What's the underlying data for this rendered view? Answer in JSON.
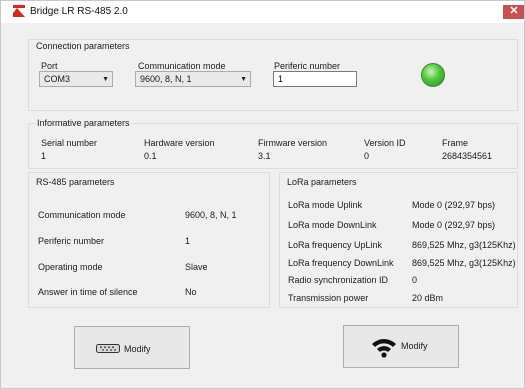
{
  "window": {
    "title": "Bridge LR RS-485 2.0",
    "close_label": "✕"
  },
  "connection": {
    "title": "Connection parameters",
    "port_label": "Port",
    "port_value": "COM3",
    "mode_label": "Communication mode",
    "mode_value": "9600, 8, N, 1",
    "periferic_label": "Periferic number",
    "periferic_value": "1",
    "status_color": "#4cc43a"
  },
  "informative": {
    "title": "Informative parameters",
    "serial_label": "Serial number",
    "serial_value": "1",
    "hw_label": "Hardware version",
    "hw_value": "0.1",
    "fw_label": "Firmware version",
    "fw_value": "3.1",
    "vid_label": "Version ID",
    "vid_value": "0",
    "frame_label": "Frame",
    "frame_value": "2684354561"
  },
  "rs485": {
    "title": "RS-485 parameters",
    "rows": [
      {
        "label": "Communication mode",
        "value": "9600, 8, N, 1"
      },
      {
        "label": "Periferic number",
        "value": "1"
      },
      {
        "label": "Operating mode",
        "value": "Slave"
      },
      {
        "label": "Answer in time of silence",
        "value": "No"
      }
    ],
    "modify_label": "Modify",
    "modify_icon": "serial-port-icon"
  },
  "lora": {
    "title": "LoRa parameters",
    "rows": [
      {
        "label": "LoRa mode Uplink",
        "value": "Mode 0 (292,97 bps)"
      },
      {
        "label": "LoRa mode DownLink",
        "value": "Mode 0 (292,97 bps)"
      },
      {
        "label": "LoRa frequency UpLink",
        "value": "869,525 Mhz, g3(125Khz)"
      },
      {
        "label": "LoRa frequency DownLink",
        "value": "869,525 Mhz, g3(125Khz)"
      },
      {
        "label": "Radio synchronization ID",
        "value": "0"
      },
      {
        "label": "Transmission power",
        "value": "20 dBm"
      }
    ],
    "modify_label": "Modify",
    "modify_icon": "wifi-icon"
  }
}
